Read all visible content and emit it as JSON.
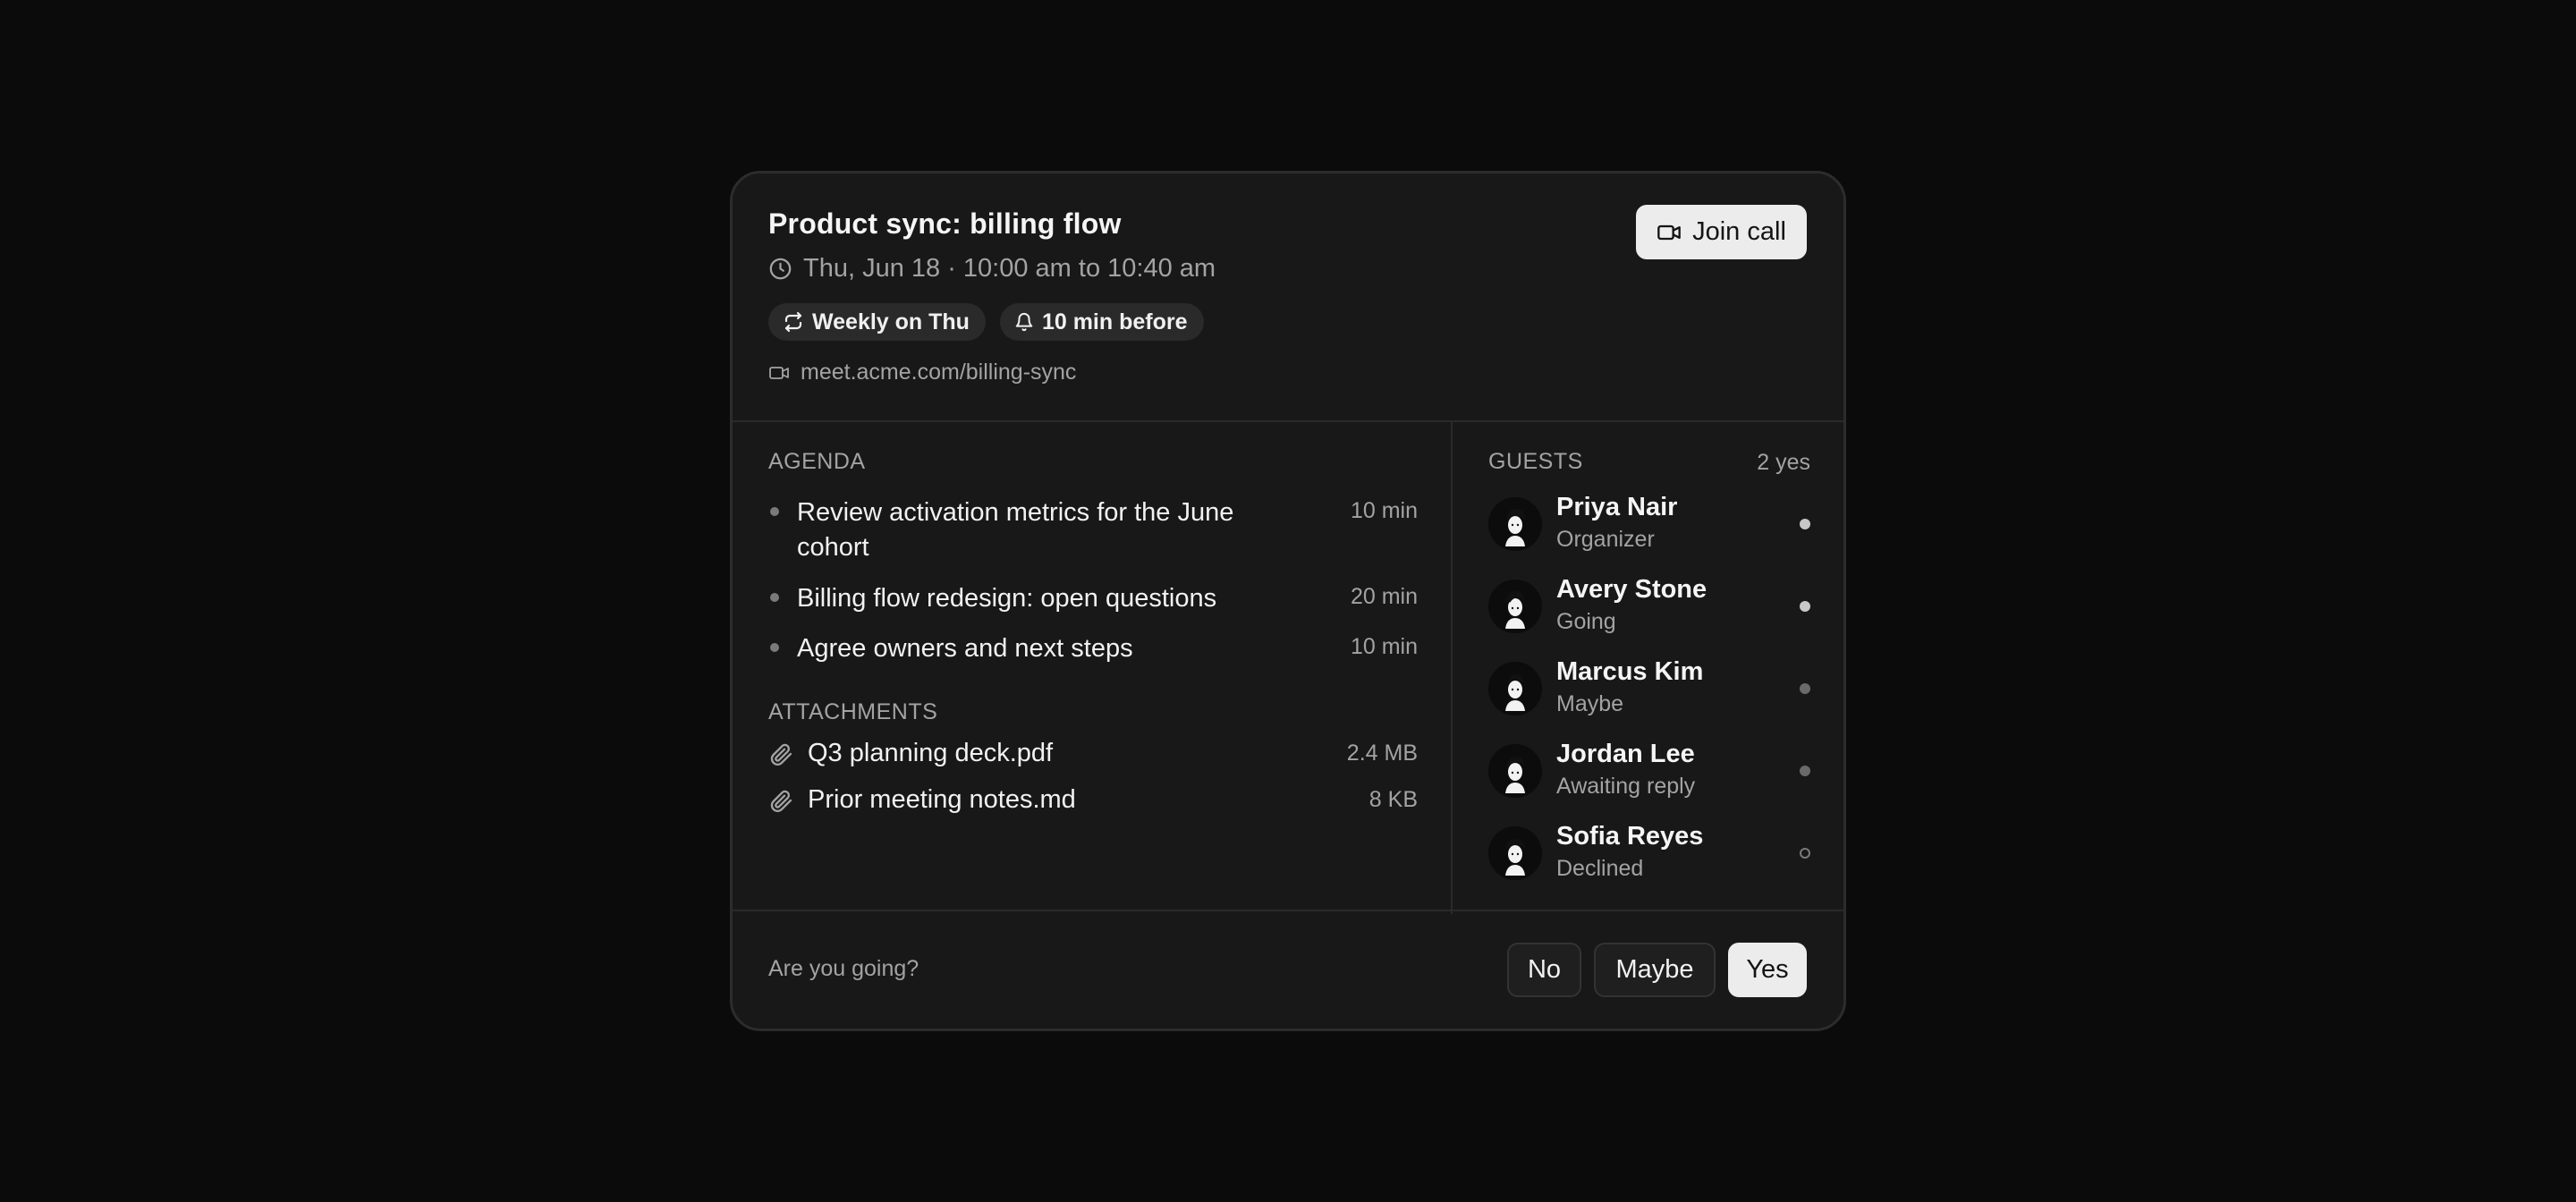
{
  "event": {
    "title": "Product sync: billing flow",
    "datetime": "Thu, Jun 18 · 10:00 am to 10:40 am",
    "chips": [
      {
        "icon": "repeat-icon",
        "label": "Weekly on Thu"
      },
      {
        "icon": "bell-icon",
        "label": "10 min before"
      }
    ],
    "meeting_link": "meet.acme.com/billing-sync",
    "join_label": "Join call"
  },
  "agenda": {
    "label": "AGENDA",
    "items": [
      {
        "text": "Review activation metrics for the June cohort",
        "duration": "10 min"
      },
      {
        "text": "Billing flow redesign: open questions",
        "duration": "20 min"
      },
      {
        "text": "Agree owners and next steps",
        "duration": "10 min"
      }
    ]
  },
  "attachments": {
    "label": "ATTACHMENTS",
    "items": [
      {
        "name": "Q3 planning deck.pdf",
        "size": "2.4 MB"
      },
      {
        "name": "Prior meeting notes.md",
        "size": "8 KB"
      }
    ]
  },
  "guests": {
    "label": "GUESTS",
    "count": "2 yes",
    "items": [
      {
        "name": "Priya Nair",
        "status": "Organizer",
        "rsvp": "yes"
      },
      {
        "name": "Avery Stone",
        "status": "Going",
        "rsvp": "yes"
      },
      {
        "name": "Marcus Kim",
        "status": "Maybe",
        "rsvp": "maybe"
      },
      {
        "name": "Jordan Lee",
        "status": "Awaiting reply",
        "rsvp": "awaiting"
      },
      {
        "name": "Sofia Reyes",
        "status": "Declined",
        "rsvp": "no"
      }
    ]
  },
  "rsvp": {
    "question": "Are you going?",
    "no_label": "No",
    "maybe_label": "Maybe",
    "yes_label": "Yes",
    "selected": "Yes"
  },
  "colors": {
    "background": "#0b0b0b",
    "card": "#181818",
    "primary_button": "#ececec",
    "muted_text": "#a3a3a3"
  }
}
